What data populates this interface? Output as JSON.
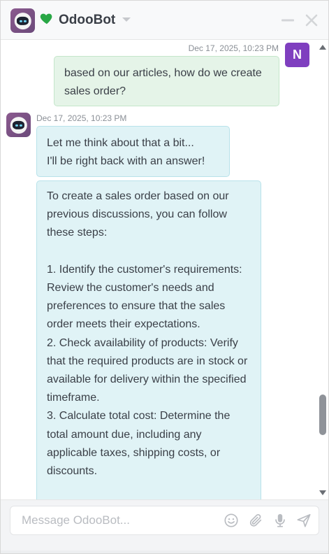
{
  "header": {
    "title": "OdooBot",
    "status_icon": "heart-icon",
    "status_color": "#28a745",
    "actions": [
      "minimize-icon",
      "close-icon"
    ]
  },
  "thread": {
    "user_message": {
      "author_initial": "N",
      "avatar_color": "#7f3fbf",
      "date": "Dec 17, 2025, 10:23 PM",
      "text": "based on our articles, how do we create sales order?"
    },
    "bot_messages": {
      "date": "Dec 17, 2025, 10:23 PM",
      "first": "Let me think about that a bit...\nI'll be right back with an answer!",
      "second": "To create a sales order based on our previous discussions, you can follow these steps:\n\n1. Identify the customer's requirements: Review the customer's needs and preferences to ensure that the sales order meets their expectations.\n2. Check availability of products: Verify that the required products are in stock or available for delivery within the specified timeframe.\n3. Calculate total cost: Determine the total amount due, including any applicable taxes, shipping costs, or discounts."
    }
  },
  "composer": {
    "placeholder": "Message OdooBot...",
    "icons": [
      "emoji-icon",
      "paperclip-icon",
      "microphone-icon",
      "send-icon"
    ]
  },
  "colors": {
    "user_bubble": "#e5f4e8",
    "bot_bubble": "#e0f3f6",
    "text": "#3a3f47"
  }
}
